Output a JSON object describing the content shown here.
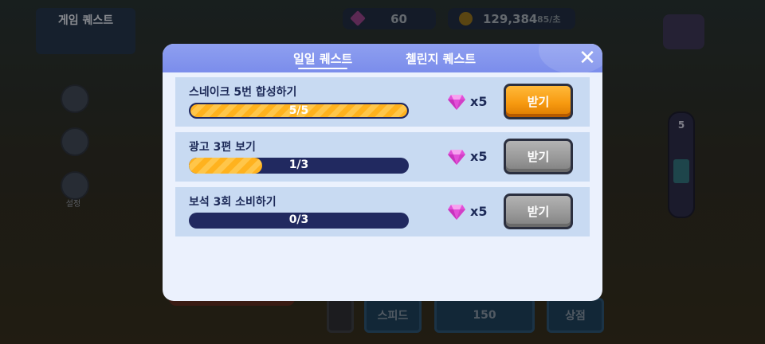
{
  "background": {
    "panel_title": "게임 퀘스트",
    "panel_subtitle": "",
    "gems": "60",
    "coins": "129,384",
    "coin_rate": "85/초",
    "side_items": [
      "",
      "",
      "설정"
    ],
    "tower_level": "5",
    "speed_label": "스피드",
    "buy_cost": "150",
    "shop_label": "상점"
  },
  "modal": {
    "tabs": [
      {
        "label": "일일 퀘스트",
        "active": true
      },
      {
        "label": "첼린지 퀘스트",
        "active": false
      }
    ],
    "close_icon": "✕",
    "quests": [
      {
        "title": "스네이크 5번 합성하기",
        "progress_text": "5/5",
        "progress": 1.0,
        "reward_qty": "x5",
        "claim_label": "받기",
        "claimable": true
      },
      {
        "title": "광고 3편 보기",
        "progress_text": "1/3",
        "progress": 0.3333,
        "reward_qty": "x5",
        "claim_label": "받기",
        "claimable": false
      },
      {
        "title": "보석 3회 소비하기",
        "progress_text": "0/3",
        "progress": 0.0,
        "reward_qty": "x5",
        "claim_label": "받기",
        "claimable": false
      }
    ]
  },
  "colors": {
    "header": "#8e9ff0",
    "row": "#c8daf2",
    "progress_track": "#212960",
    "progress_fill": "#ffb21e",
    "claim_active": "#f79a10",
    "claim_disabled": "#999999",
    "gem": "#e24fd8"
  }
}
